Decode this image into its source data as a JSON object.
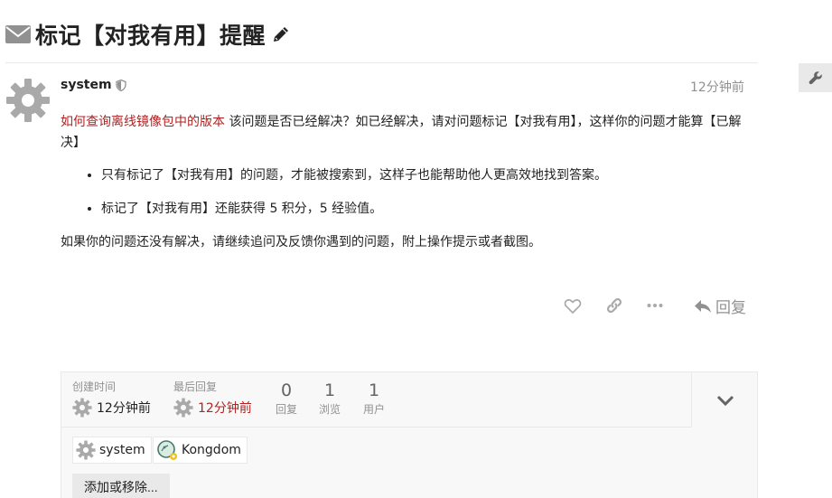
{
  "topic": {
    "title": "标记【对我有用】提醒"
  },
  "post": {
    "username": "system",
    "date": "12分钟前",
    "link_text": "如何查询离线镜像包中的版本",
    "intro_text": " 该问题是否已经解决？如已经解决，请对问题标记【对我有用】，这样你的问题才能算【已解决】",
    "bullets": [
      "只有标记了【对我有用】的问题，才能被搜索到，这样子也能帮助他人更高效地找到答案。",
      "标记了【对我有用】还能获得 5 积分，5 经验值。"
    ],
    "closing_text": "如果你的问题还没有解决，请继续追问及反馈你遇到的问题，附上操作提示或者截图。",
    "reply_label": "回复"
  },
  "summary": {
    "created_label": "创建时间",
    "created_value": "12分钟前",
    "last_reply_label": "最后回复",
    "last_reply_value": "12分钟前",
    "stats": [
      {
        "num": "0",
        "label": "回复"
      },
      {
        "num": "1",
        "label": "浏览"
      },
      {
        "num": "1",
        "label": "用户"
      }
    ],
    "participants": [
      {
        "name": "system"
      },
      {
        "name": "Kongdom"
      }
    ],
    "add_remove_label": "添加或移除..."
  },
  "colors": {
    "link": "#b22222",
    "muted": "#919191",
    "border": "#e9e9e9"
  },
  "icons": [
    "envelope-icon",
    "pencil-icon",
    "wrench-icon",
    "gear-avatar-icon",
    "shield-icon",
    "heart-icon",
    "link-icon",
    "ellipsis-icon",
    "reply-arrow-icon",
    "chevron-down-icon"
  ]
}
